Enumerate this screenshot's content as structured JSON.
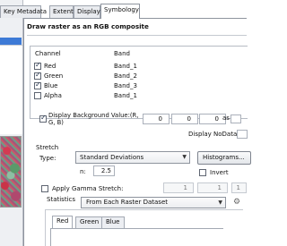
{
  "tabs": [
    {
      "label": "Key Metadata",
      "active": false
    },
    {
      "label": "Extent",
      "active": false
    },
    {
      "label": "Display",
      "active": false
    },
    {
      "label": "Symbology",
      "active": true
    }
  ],
  "heading": "Draw raster as an RGB composite",
  "grid": {
    "columns": [
      "Channel",
      "Band"
    ],
    "rows": [
      {
        "channel": "Red",
        "band": "Band_1",
        "checked": true
      },
      {
        "channel": "Green",
        "band": "Band_2",
        "checked": true
      },
      {
        "channel": "Blue",
        "band": "Band_3",
        "checked": true
      },
      {
        "channel": "Alpha",
        "band": "Band_1",
        "checked": false
      }
    ]
  },
  "background": {
    "label": "Display Background Value:(R, G, B)",
    "checked": true,
    "values": [
      "0",
      "0",
      "0"
    ],
    "as_label": "as"
  },
  "nodata": {
    "label": "Display NoData as"
  },
  "stretch": {
    "group_label": "Stretch",
    "type_label": "Type:",
    "type_value": "Standard Deviations",
    "histograms_button": "Histograms...",
    "n_label": "n:",
    "n_value": "2.5",
    "invert_label": "Invert",
    "invert_checked": false
  },
  "gamma": {
    "label": "Apply Gamma Stretch:",
    "checked": false,
    "values": [
      "1",
      "1",
      "1"
    ]
  },
  "statistics": {
    "label": "Statistics",
    "value": "From Each Raster Dataset"
  },
  "channel_tabs": [
    {
      "label": "Red",
      "active": true
    },
    {
      "label": "Green",
      "active": false
    },
    {
      "label": "Blue",
      "active": false
    }
  ],
  "colors": {
    "accent": "#3d7ad6",
    "border": "#8e949e"
  }
}
